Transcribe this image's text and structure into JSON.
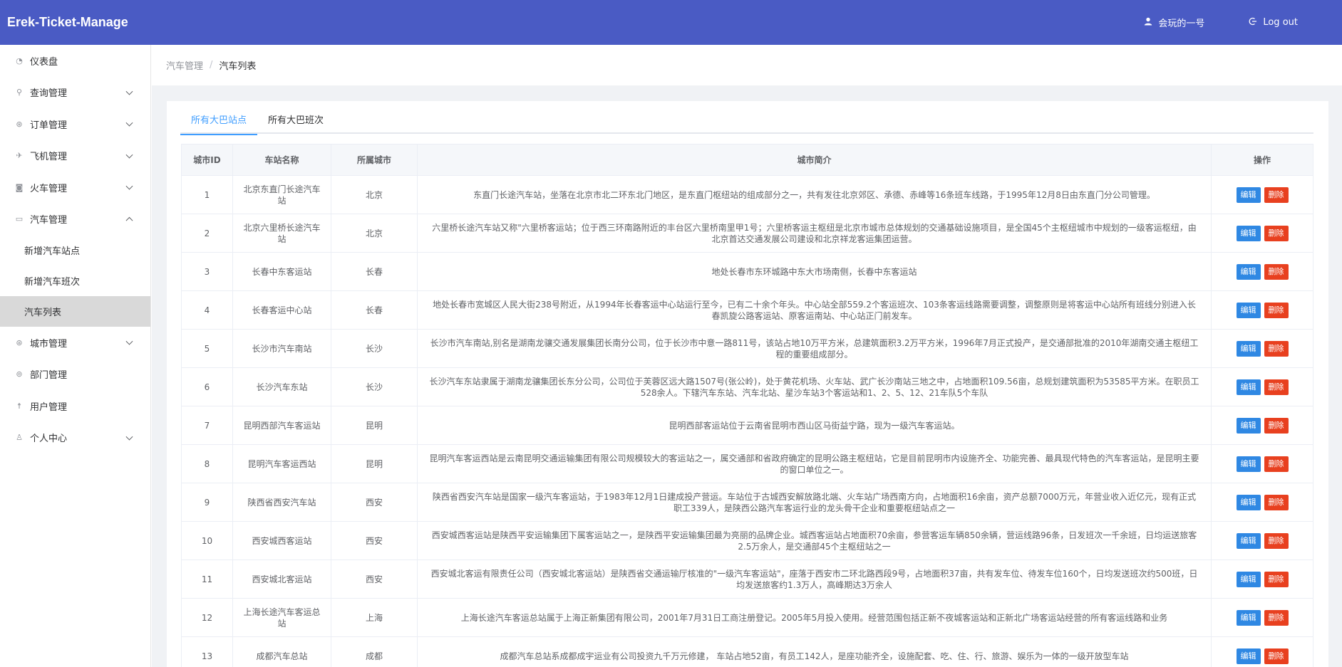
{
  "header": {
    "brand": "Erek-Ticket-Manage",
    "user_name": "会玩的一号",
    "logout_label": "Log out"
  },
  "sidebar": {
    "items": [
      {
        "label": "仪表盘",
        "icon": "dashboard-icon",
        "has_arrow": false
      },
      {
        "label": "查询管理",
        "icon": "search-icon",
        "has_arrow": true
      },
      {
        "label": "订单管理",
        "icon": "order-icon",
        "has_arrow": true
      },
      {
        "label": "飞机管理",
        "icon": "plane-icon",
        "has_arrow": true
      },
      {
        "label": "火车管理",
        "icon": "train-icon",
        "has_arrow": true
      },
      {
        "label": "汽车管理",
        "icon": "bus-icon",
        "has_arrow": true,
        "expanded": true
      }
    ],
    "sub_items": [
      {
        "label": "新增汽车站点"
      },
      {
        "label": "新增汽车班次"
      },
      {
        "label": "汽车列表",
        "active": true
      }
    ],
    "items_after": [
      {
        "label": "城市管理",
        "icon": "city-icon",
        "has_arrow": true
      },
      {
        "label": "部门管理",
        "icon": "department-icon",
        "has_arrow": false
      },
      {
        "label": "用户管理",
        "icon": "user-manage-icon",
        "has_arrow": false
      },
      {
        "label": "个人中心",
        "icon": "profile-icon",
        "has_arrow": true
      }
    ]
  },
  "breadcrumb": {
    "parent": "汽车管理",
    "separator": "/",
    "current": "汽车列表"
  },
  "tabs": [
    {
      "label": "所有大巴站点",
      "active": true
    },
    {
      "label": "所有大巴班次",
      "active": false
    }
  ],
  "table": {
    "headers": [
      "城市ID",
      "车站名称",
      "所属城市",
      "城市简介",
      "操作"
    ],
    "edit_label": "编辑",
    "delete_label": "删除",
    "rows": [
      {
        "id": "1",
        "name": "北京东直门长途汽车站",
        "city": "北京",
        "desc": "东直门长途汽车站，坐落在北京市北二环东北门地区，是东直门枢纽站的组成部分之一，共有发往北京郊区、承德、赤峰等16条班车线路，于1995年12月8日由东直门分公司管理。"
      },
      {
        "id": "2",
        "name": "北京六里桥长途汽车站",
        "city": "北京",
        "desc": "六里桥长途汽车站又称\"六里桥客运站；位于西三环南路附近的丰台区六里桥南里甲1号；六里桥客运主枢纽是北京市城市总体规划的交通基础设施项目，是全国45个主枢纽城市中规划的一级客运枢纽，由北京首达交通发展公司建设和北京祥龙客运集团运营。"
      },
      {
        "id": "3",
        "name": "长春中东客运站",
        "city": "长春",
        "desc": "地处长春市东环城路中东大市场南侧，长春中东客运站"
      },
      {
        "id": "4",
        "name": "长春客运中心站",
        "city": "长春",
        "desc": "地处长春市宽城区人民大街238号附近，从1994年长春客运中心站运行至今，已有二十余个年头。中心站全部559.2个客运班次、103条客运线路需要调整，调整原则是将客运中心站所有班线分别进入长春凯旋公路客运站、原客运南站、中心站正门前发车。"
      },
      {
        "id": "5",
        "name": "长沙市汽车南站",
        "city": "长沙",
        "desc": "长沙市汽车南站,别名是湖南龙骧交通发展集团长南分公司，位于长沙市中意一路811号，该站占地10万平方米，总建筑面积3.2万平方米，1996年7月正式投产，是交通部批准的2010年湖南交通主枢纽工程的重要组成部分。"
      },
      {
        "id": "6",
        "name": "长沙汽车东站",
        "city": "长沙",
        "desc": "长沙汽车东站隶属于湖南龙骧集团长东分公司，公司位于芙蓉区远大路1507号(张公岭)，处于黄花机场、火车站、武广长沙南站三地之中，占地面积109.56亩，总规划建筑面积为53585平方米。在职员工528余人。下辖汽车东站、汽车北站、星沙车站3个客运站和1、2、5、12、21车队5个车队"
      },
      {
        "id": "7",
        "name": "昆明西部汽车客运站",
        "city": "昆明",
        "desc": "昆明西部客运站位于云南省昆明市西山区马街益宁路，现为一级汽车客运站。"
      },
      {
        "id": "8",
        "name": "昆明汽车客运西站",
        "city": "昆明",
        "desc": "昆明汽车客运西站是云南昆明交通运输集团有限公司规模较大的客运站之一，属交通部和省政府确定的昆明公路主枢纽站，它是目前昆明市内设施齐全、功能完善、最具现代特色的汽车客运站，是昆明主要的窗口单位之一。"
      },
      {
        "id": "9",
        "name": "陕西省西安汽车站",
        "city": "西安",
        "desc": "陕西省西安汽车站是国家一级汽车客运站，于1983年12月1日建成投产营运。车站位于古城西安解放路北端、火车站广场西南方向，占地面积16余亩，资产总额7000万元，年营业收入近亿元，现有正式职工339人，是陕西公路汽车客运行业的龙头骨干企业和重要枢纽站点之一"
      },
      {
        "id": "10",
        "name": "西安城西客运站",
        "city": "西安",
        "desc": "西安城西客运站是陕西平安运输集团下属客运站之一，是陕西平安运输集团最为亮丽的品牌企业。城西客运站占地面积70余亩，参营客运车辆850余辆，营运线路96条，日发班次一千余班，日均运送旅客2.5万余人，是交通部45个主枢纽站之一"
      },
      {
        "id": "11",
        "name": "西安城北客运站",
        "city": "西安",
        "desc": "西安城北客运有限责任公司（西安城北客运站）是陕西省交通运输厅核准的\"一级汽车客运站\"，座落于西安市二环北路西段9号，占地面积37亩，共有发车位、待发车位160个，日均发送班次约500班，日均发送旅客约1.3万人，高峰期达3万余人"
      },
      {
        "id": "12",
        "name": "上海长途汽车客运总站",
        "city": "上海",
        "desc": "上海长途汽车客运总站属于上海正新集团有限公司，2001年7月31日工商注册登记。2005年5月投入使用。经营范围包括正新不夜城客运站和正新北广场客运站经营的所有客运线路和业务"
      },
      {
        "id": "13",
        "name": "成都汽车总站",
        "city": "成都",
        "desc": "成都汽车总站系成都成宇运业有公司投资九千万元修建， 车站占地52亩，有员工142人，是座功能齐全，设施配套、吃、住、行、旅游、娱乐为一体的一级开放型车站"
      }
    ]
  }
}
